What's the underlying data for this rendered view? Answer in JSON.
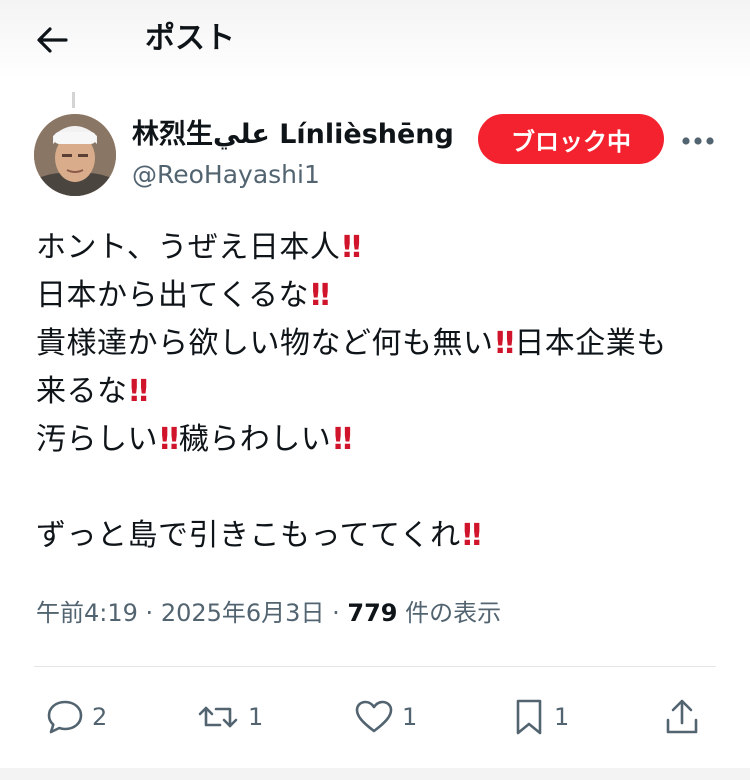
{
  "header": {
    "title": "ポスト",
    "back_icon": "arrow-left-icon"
  },
  "author": {
    "display_name": "林烈生علي Línlièshēng",
    "handle": "@ReoHayashi1"
  },
  "block_button": {
    "label": "ブロック中",
    "color": "#f4212e"
  },
  "more_icon": "more-horizontal-icon",
  "tweet": {
    "lines": [
      {
        "segments": [
          {
            "text": "ホント、うぜえ日本人"
          },
          {
            "emoji": "‼"
          }
        ]
      },
      {
        "segments": [
          {
            "text": "日本から出てくるな"
          },
          {
            "emoji": "‼"
          }
        ]
      },
      {
        "segments": [
          {
            "text": "貴様達から欲しい物など何も無い"
          },
          {
            "emoji": "‼"
          },
          {
            "text": "日本企業も"
          }
        ]
      },
      {
        "segments": [
          {
            "text": "来るな"
          },
          {
            "emoji": "‼"
          }
        ]
      },
      {
        "segments": [
          {
            "text": "汚らしい"
          },
          {
            "emoji": "‼"
          },
          {
            "text": "穢らわしい"
          },
          {
            "emoji": "‼"
          }
        ]
      },
      {
        "segments": []
      },
      {
        "segments": [
          {
            "text": "ずっと島で引きこもっててくれ"
          },
          {
            "emoji": "‼"
          }
        ]
      }
    ]
  },
  "meta": {
    "time": "午前4:19",
    "separator": "·",
    "date": "2025年6月3日",
    "views_count": "779",
    "views_label": "件の表示"
  },
  "actions": {
    "reply": {
      "icon": "reply-icon",
      "count": "2"
    },
    "repost": {
      "icon": "repost-icon",
      "count": "1"
    },
    "like": {
      "icon": "heart-icon",
      "count": "1"
    },
    "bookmark": {
      "icon": "bookmark-icon",
      "count": "1"
    },
    "share": {
      "icon": "share-icon"
    }
  },
  "colors": {
    "accent_red": "#f4212e",
    "text": "#0f1419",
    "secondary": "#536471",
    "emoji_red": "#d0142b"
  }
}
